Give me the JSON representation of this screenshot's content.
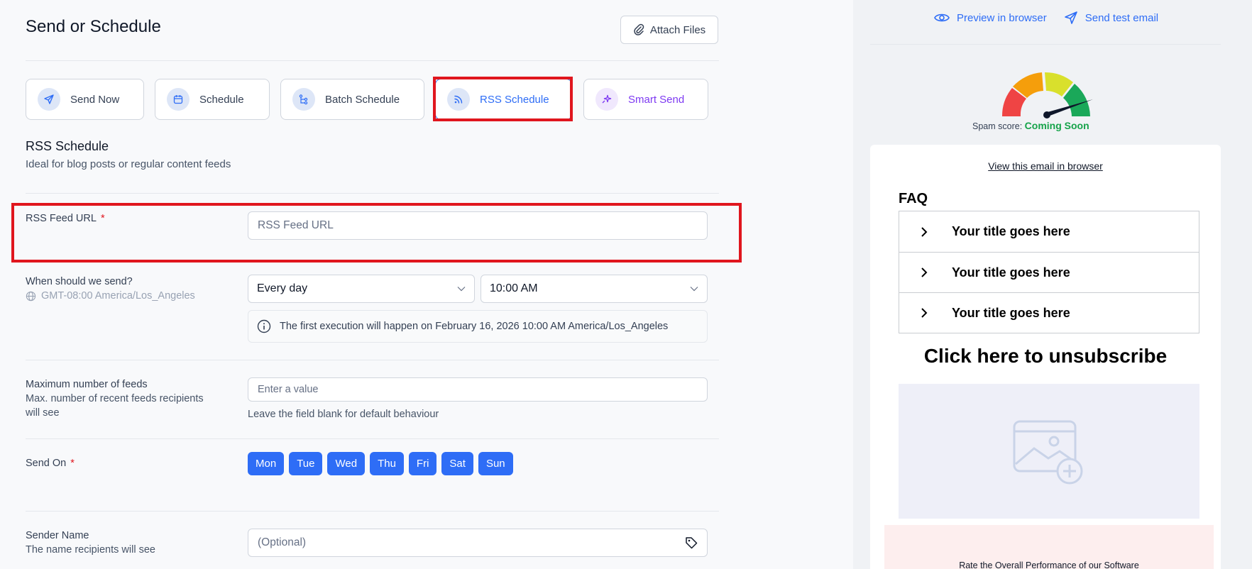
{
  "header": {
    "title": "Send or Schedule",
    "attach_label": "Attach Files"
  },
  "tabs": [
    {
      "label": "Send Now",
      "icon": "send-icon"
    },
    {
      "label": "Schedule",
      "icon": "calendar-icon"
    },
    {
      "label": "Batch Schedule",
      "icon": "batch-icon"
    },
    {
      "label": "RSS Schedule",
      "icon": "rss-icon",
      "active": true
    },
    {
      "label": "Smart Send",
      "icon": "sparkle-icon"
    }
  ],
  "section": {
    "title": "RSS Schedule",
    "subtitle": "Ideal for blog posts or regular content feeds"
  },
  "rss": {
    "label": "RSS Feed URL",
    "required": "*",
    "placeholder": "RSS Feed URL"
  },
  "when": {
    "label": "When should we send?",
    "timezone": "GMT-08:00 America/Los_Angeles",
    "frequency": "Every day",
    "time": "10:00 AM",
    "info": "The first execution will happen on February 16, 2026 10:00 AM America/Los_Angeles"
  },
  "max_feeds": {
    "label": "Maximum number of feeds",
    "sub": "Max. number of recent feeds recipients will see",
    "placeholder": "Enter a value",
    "hint": "Leave the field blank for default behaviour"
  },
  "send_on": {
    "label": "Send On",
    "required": "*",
    "days": [
      "Mon",
      "Tue",
      "Wed",
      "Thu",
      "Fri",
      "Sat",
      "Sun"
    ]
  },
  "sender": {
    "label": "Sender Name",
    "sub": "The name recipients will see",
    "placeholder": "(Optional)"
  },
  "preview": {
    "preview_label": "Preview in browser",
    "test_label": "Send test email",
    "spam_label": "Spam score:",
    "spam_value": "Coming Soon",
    "view_link": "View this email in browser",
    "faq_title": "FAQ",
    "faq_items": [
      "Your title goes here",
      "Your title goes here",
      "Your title goes here"
    ],
    "unsubscribe": "Click here to unsubscribe",
    "rate_text": "Rate the Overall Performance of our Software"
  },
  "colors": {
    "accent": "#2e6df6",
    "highlight": "#e0161e",
    "smart": "#7e3af2",
    "spam_ok": "#16a34a"
  }
}
